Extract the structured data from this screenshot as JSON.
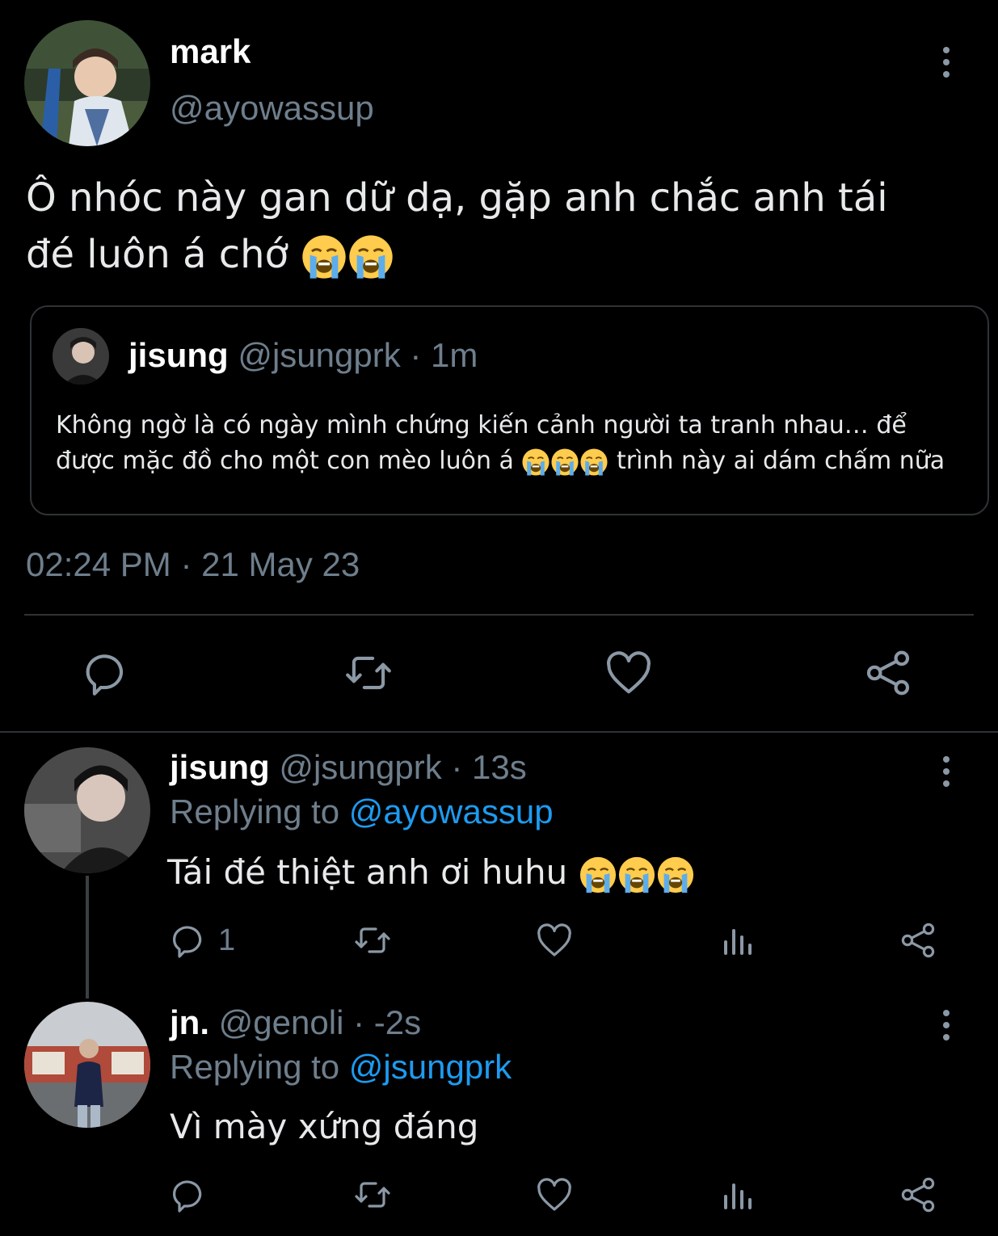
{
  "main_tweet": {
    "name": "mark",
    "handle": "@ayowassup",
    "text_line1": "Ô nhóc này gan dữ dạ, gặp anh chắc anh tái",
    "text_line2": "đé luôn á chớ",
    "emoji_count": 2,
    "timestamp": "02:24 PM · 21 May 23"
  },
  "quoted": {
    "name": "jisung",
    "handle": "@jsungprk",
    "time": "· 1m",
    "text_line1": "Không ngờ là có ngày mình chứng kiến cảnh người ta tranh nhau… để",
    "text_line2_a": "được mặc đồ cho một con mèo luôn á",
    "text_line2_b": "trình này ai dám chấm nữa"
  },
  "replies": [
    {
      "name": "jisung",
      "handle": "@jsungprk",
      "time": "· 13s",
      "replying_prefix": "Replying to",
      "replying_to": "@ayowassup",
      "text": "Tái đé thiệt anh ơi huhu",
      "reply_count": "1"
    },
    {
      "name": "jn.",
      "handle": "@genoli",
      "time": "· -2s",
      "replying_prefix": "Replying to",
      "replying_to": "@jsungprk",
      "text": "Vì mày xứng đáng"
    }
  ],
  "icons": {
    "reply": "reply-icon",
    "retweet": "retweet-icon",
    "like": "heart-icon",
    "share": "share-icon",
    "views": "views-icon",
    "more": "more-icon"
  },
  "colors": {
    "background": "#000000",
    "text": "#e7e9ea",
    "muted": "#6e7e8c",
    "link": "#1d9bf0",
    "divider": "#2f3336"
  }
}
